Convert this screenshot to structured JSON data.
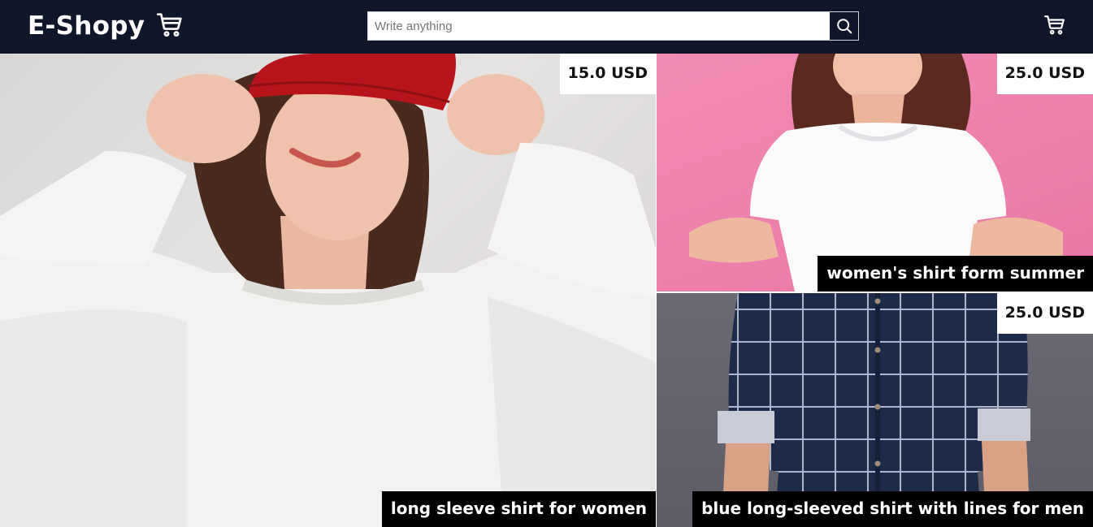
{
  "header": {
    "logo_text": "E-Shopy",
    "logo_icon": "cart-icon",
    "search": {
      "placeholder": "Write anything",
      "value": "",
      "button_icon": "search-icon"
    },
    "cart_icon": "cart-icon",
    "background_color": "#0f1629"
  },
  "products": [
    {
      "price": "15.0 USD",
      "name": "long sleeve shirt for women"
    },
    {
      "price": "25.0 USD",
      "name": "women's shirt form summer"
    },
    {
      "price": "25.0 USD",
      "name": "blue long-sleeved shirt with lines for men"
    }
  ]
}
